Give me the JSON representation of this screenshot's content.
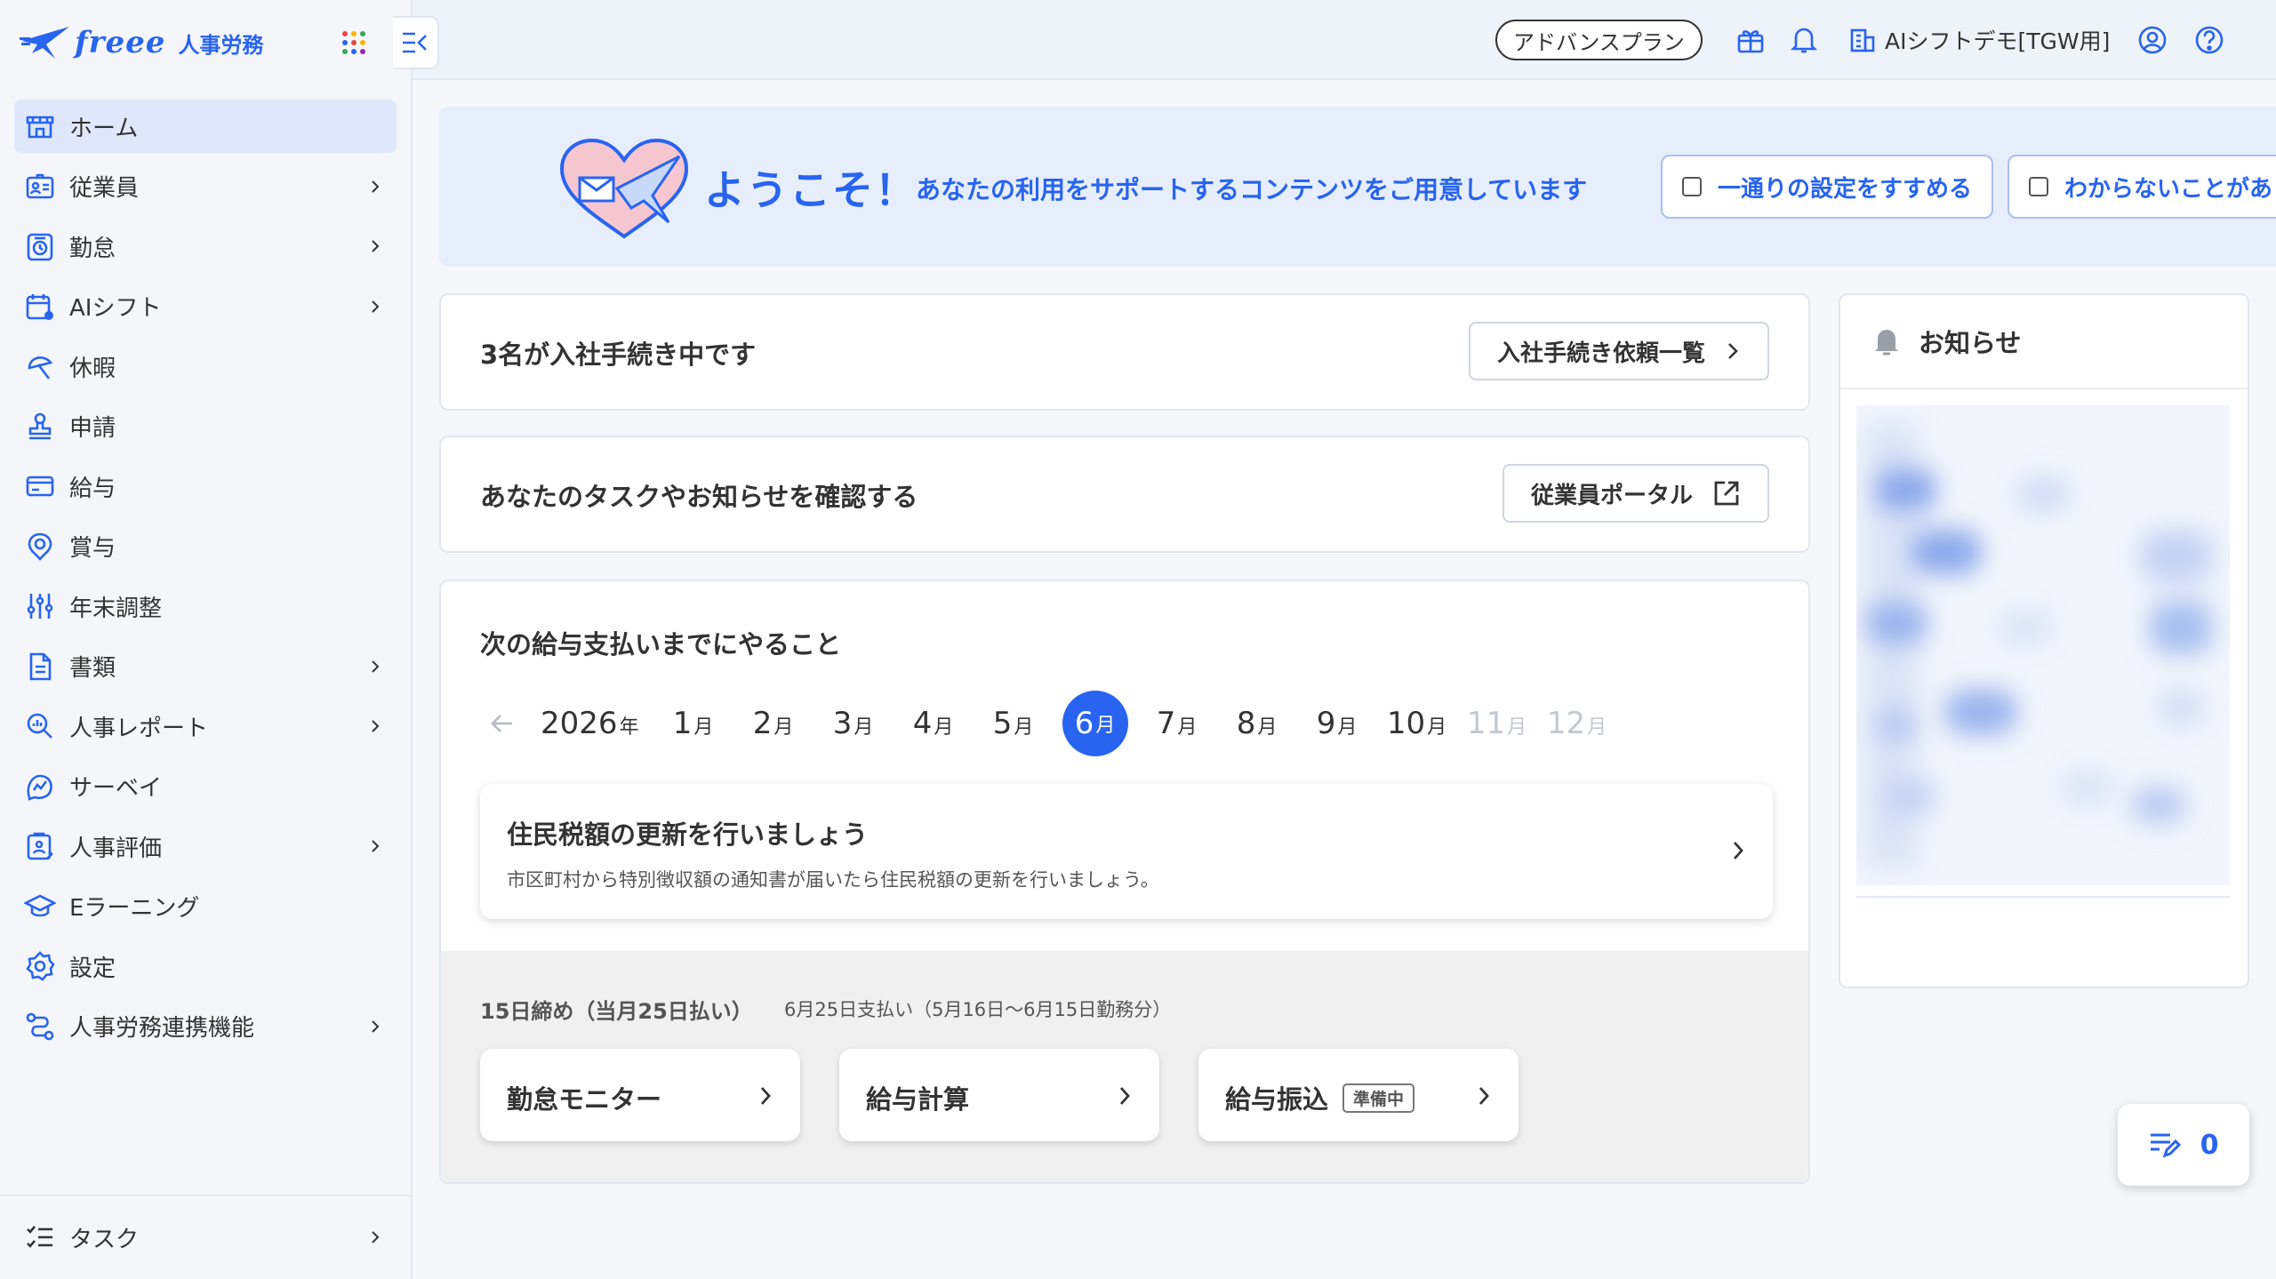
{
  "brand": {
    "logo_text": "freee",
    "product": "人事労務"
  },
  "sidebar": {
    "items": [
      {
        "label": "ホーム",
        "icon": "home-icon",
        "active": true,
        "has_children": false
      },
      {
        "label": "従業員",
        "icon": "employee-card-icon",
        "has_children": true
      },
      {
        "label": "勤怠",
        "icon": "timer-icon",
        "has_children": true
      },
      {
        "label": "AIシフト",
        "icon": "calendar-icon",
        "has_children": true
      },
      {
        "label": "休暇",
        "icon": "umbrella-icon",
        "has_children": false
      },
      {
        "label": "申請",
        "icon": "stamp-icon",
        "has_children": false
      },
      {
        "label": "給与",
        "icon": "card-icon",
        "has_children": false
      },
      {
        "label": "賞与",
        "icon": "award-icon",
        "has_children": false
      },
      {
        "label": "年末調整",
        "icon": "sliders-icon",
        "has_children": false
      },
      {
        "label": "書類",
        "icon": "document-icon",
        "has_children": true
      },
      {
        "label": "人事レポート",
        "icon": "report-search-icon",
        "has_children": true
      },
      {
        "label": "サーベイ",
        "icon": "survey-icon",
        "has_children": false
      },
      {
        "label": "人事評価",
        "icon": "evaluation-icon",
        "has_children": true
      },
      {
        "label": "Eラーニング",
        "icon": "graduation-cap-icon",
        "has_children": false
      },
      {
        "label": "設定",
        "icon": "gear-icon",
        "has_children": false
      },
      {
        "label": "人事労務連携機能",
        "icon": "integration-icon",
        "has_children": true
      }
    ],
    "bottom": {
      "label": "タスク",
      "icon": "checklist-icon"
    }
  },
  "header": {
    "plan": "アドバンスプラン",
    "company": "AIシフトデモ[TGW用]"
  },
  "welcome": {
    "title": "ようこそ！",
    "subtitle": "あなたの利用をサポートするコンテンツをご用意しています",
    "buttons": [
      "一通りの設定をすすめる",
      "わからないことがあ"
    ]
  },
  "onboarding": {
    "title": "3名が入社手続き中です",
    "button": "入社手続き依頼一覧"
  },
  "portal": {
    "title": "あなたのタスクやお知らせを確認する",
    "button": "従業員ポータル"
  },
  "payroll": {
    "title": "次の給与支払いまでにやること",
    "year": "2026",
    "year_unit": "年",
    "month_unit": "月",
    "months": [
      {
        "n": "1",
        "state": "normal"
      },
      {
        "n": "2",
        "state": "normal"
      },
      {
        "n": "3",
        "state": "normal"
      },
      {
        "n": "4",
        "state": "normal"
      },
      {
        "n": "5",
        "state": "normal"
      },
      {
        "n": "6",
        "state": "selected"
      },
      {
        "n": "7",
        "state": "normal"
      },
      {
        "n": "8",
        "state": "normal"
      },
      {
        "n": "9",
        "state": "normal"
      },
      {
        "n": "10",
        "state": "normal"
      },
      {
        "n": "11",
        "state": "dim"
      },
      {
        "n": "12",
        "state": "dim"
      }
    ],
    "task": {
      "title": "住民税額の更新を行いましょう",
      "desc": "市区町村から特別徴収額の通知書が届いたら住民税額の更新を行いましょう。"
    },
    "cycle": {
      "title": "15日締め（当月25日払い）",
      "detail": "6月25日支払い（5月16日〜6月15日勤務分）",
      "steps": [
        {
          "label": "勤怠モニター",
          "tag": ""
        },
        {
          "label": "給与計算",
          "tag": ""
        },
        {
          "label": "給与振込",
          "tag": "準備中"
        }
      ]
    }
  },
  "notice": {
    "title": "お知らせ"
  },
  "counter": {
    "value": "0"
  },
  "colors": {
    "accent": "#2864f0",
    "active_bg": "#dfe8fb",
    "welcome_bg": "#e7eefb"
  }
}
